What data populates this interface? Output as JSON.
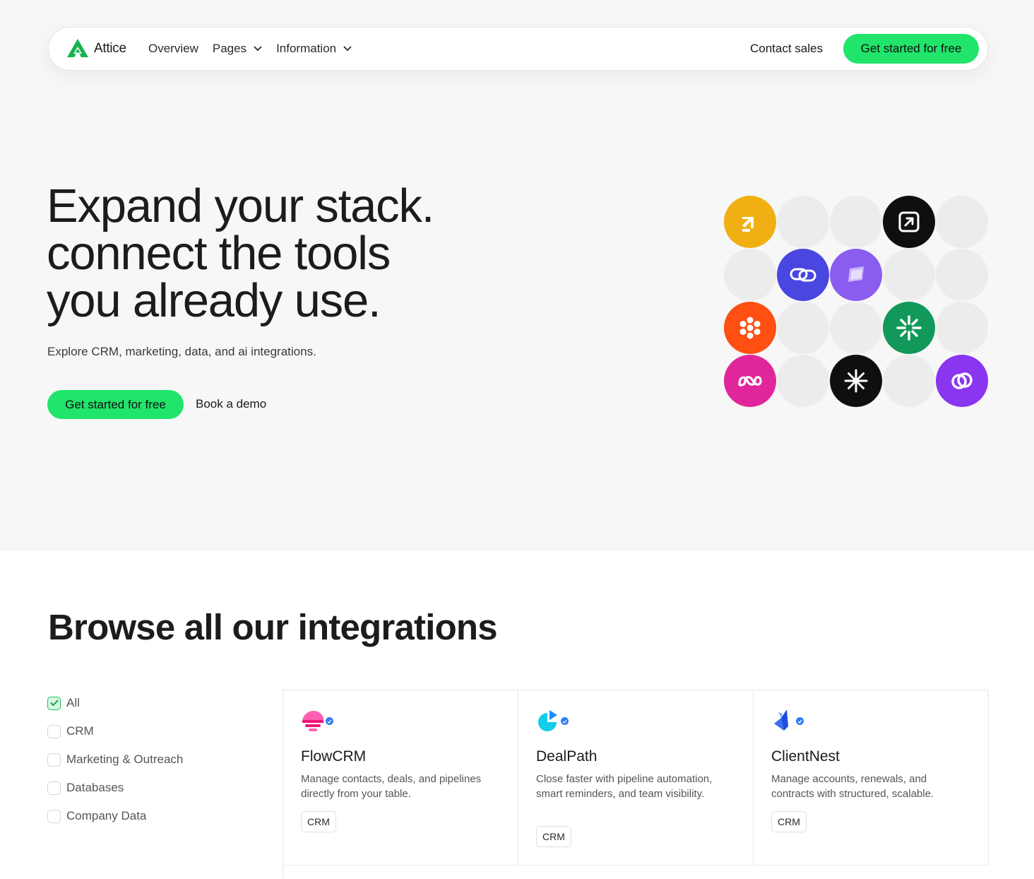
{
  "nav": {
    "brand": "Attice",
    "links": [
      {
        "label": "Overview"
      },
      {
        "label": "Pages"
      },
      {
        "label": "Information"
      }
    ],
    "contact_label": "Contact sales",
    "cta_label": "Get started for free"
  },
  "hero": {
    "headline": [
      "Expand your stack.",
      "connect the tools",
      "you already use."
    ],
    "subhead": "Explore CRM, marketing, data, and ai integrations.",
    "primary_cta": "Get started for free",
    "secondary_cta": "Book a demo"
  },
  "icon_grid": {
    "icons": [
      "arrow-up-right-icon",
      "arrow-square-icon",
      "chain-link-icon",
      "layers-icon",
      "flower-dots-icon",
      "asterisk-burst-icon",
      "loop-waves-icon",
      "sparkle-icon",
      "intertwined-rings-icon"
    ],
    "colors": {
      "yellow": "#f0b013",
      "black": "#0f0f0f",
      "blue": "#4a46e0",
      "violet": "#8a5cf0",
      "orange": "#ff4f12",
      "green": "#12985a",
      "magenta": "#e1259a",
      "purple": "#8a35f0",
      "placeholder": "#ececec"
    }
  },
  "browse": {
    "title": "Browse all our integrations",
    "filters": [
      {
        "label": "All",
        "checked": true
      },
      {
        "label": "CRM",
        "checked": false
      },
      {
        "label": "Marketing & Outreach",
        "checked": false
      },
      {
        "label": "Databases",
        "checked": false
      },
      {
        "label": "Company Data",
        "checked": false
      }
    ],
    "cards": [
      {
        "name": "FlowCRM",
        "description": "Manage contacts, deals, and pipelines directly from your table.",
        "tag": "CRM",
        "icon": "flowcrm-logo-icon"
      },
      {
        "name": "DealPath",
        "description": "Close faster with pipeline automation, smart reminders, and team visibility.",
        "tag": "CRM",
        "icon": "dealpath-logo-icon"
      },
      {
        "name": "ClientNest",
        "description": "Manage accounts, renewals, and contracts with structured, scalable.",
        "tag": "CRM",
        "icon": "clientnest-logo-icon"
      }
    ]
  },
  "colors": {
    "accent": "#21e46a",
    "verified": "#2f7bf5"
  }
}
